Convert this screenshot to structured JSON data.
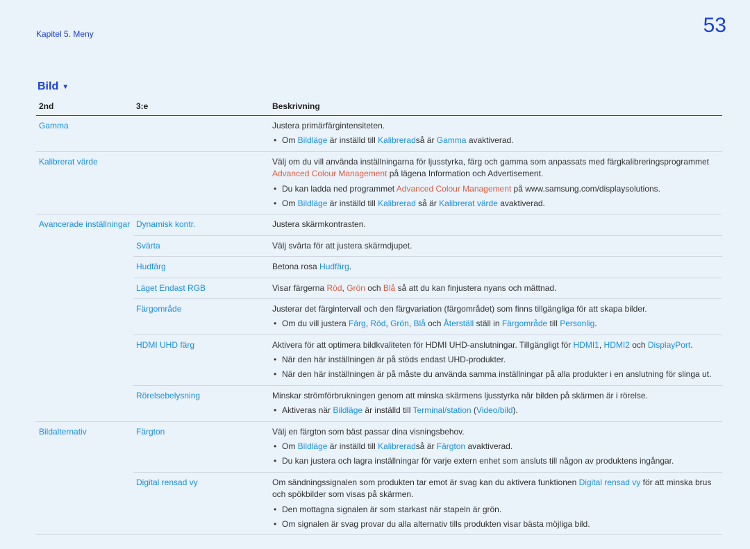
{
  "header": {
    "chapter": "Kapitel 5. Meny",
    "page": "53"
  },
  "section": {
    "title": "Bild"
  },
  "tableHead": {
    "c1": "2nd",
    "c2": "3:e",
    "c3": "Beskrivning"
  },
  "row1": {
    "c1": "Gamma",
    "p1": "Justera primärfärgintensiteten.",
    "b1_a": "Om ",
    "b1_b": "Bildläge",
    "b1_c": " är inställd till ",
    "b1_d": "Kalibrerad",
    "b1_e": "så är ",
    "b1_f": "Gamma",
    "b1_g": " avaktiverad."
  },
  "row2": {
    "c1": "Kalibrerat värde",
    "p1": "Välj om du vill använda inställningarna för ljusstyrka, färg och gamma som anpassats med färgkalibreringsprogrammet ",
    "p1_hl": "Advanced Colour Management",
    "p1_after": " på lägena Information och Advertisement.",
    "b1_a": "Du kan ladda ned programmet ",
    "b1_b": "Advanced Colour Management",
    "b1_c": " på www.samsung.com/displaysolutions.",
    "b2_a": "Om ",
    "b2_b": "Bildläge",
    "b2_c": " är inställd till ",
    "b2_d": "Kalibrerad",
    "b2_e": " så är ",
    "b2_f": "Kalibrerat värde",
    "b2_g": " avaktiverad."
  },
  "row3": {
    "c1": "Avancerade inställningar",
    "c2": "Dynamisk kontr.",
    "p1": "Justera skärmkontrasten."
  },
  "row4": {
    "c2": "Svärta",
    "p1": "Välj svärta för att justera skärmdjupet."
  },
  "row5": {
    "c2": "Hudfärg",
    "p1_a": "Betona rosa ",
    "p1_b": "Hudfärg",
    "p1_c": "."
  },
  "row6": {
    "c2": "Läget Endast RGB",
    "p1_a": "Visar färgerna ",
    "p1_b": "Röd",
    "p1_c": ", ",
    "p1_d": "Grön",
    "p1_e": " och ",
    "p1_f": "Blå",
    "p1_g": " så att du kan finjustera nyans och mättnad."
  },
  "row7": {
    "c2": "Färgområde",
    "p1": "Justerar det färgintervall och den färgvariation (färgområdet) som finns tillgängliga för att skapa bilder.",
    "b1_a": "Om du vill justera ",
    "b1_b": "Färg",
    "b1_c": ", ",
    "b1_d": "Röd",
    "b1_e": ", ",
    "b1_f": "Grön",
    "b1_g": ", ",
    "b1_h": "Blå",
    "b1_i": " och ",
    "b1_j": "Återställ",
    "b1_k": " ställ in ",
    "b1_l": "Färgområde",
    "b1_m": " till ",
    "b1_n": "Personlig",
    "b1_o": "."
  },
  "row8": {
    "c2": "HDMI UHD färg",
    "p1_a": "Aktivera för att optimera bildkvaliteten för HDMI UHD-anslutningar. Tillgängligt för ",
    "p1_b": "HDMI1",
    "p1_c": ", ",
    "p1_d": "HDMI2",
    "p1_e": " och ",
    "p1_f": "DisplayPort",
    "p1_g": ".",
    "b1": "När den här inställningen är på stöds endast UHD-produkter.",
    "b2": "När den här inställningen är på måste du använda samma inställningar på alla produkter i en anslutning för slinga ut."
  },
  "row9": {
    "c2": "Rörelsebelysning",
    "p1": "Minskar strömförbrukningen genom att minska skärmens ljusstyrka när bilden på skärmen är i rörelse.",
    "b1_a": "Aktiveras när ",
    "b1_b": "Bildläge",
    "b1_c": " är inställd till ",
    "b1_d": "Terminal/station",
    "b1_e": " (",
    "b1_f": "Video/bild",
    "b1_g": ")."
  },
  "row10": {
    "c1": "Bildalternativ",
    "c2": "Färgton",
    "p1": "Välj en färgton som bäst passar dina visningsbehov.",
    "b1_a": "Om ",
    "b1_b": "Bildläge",
    "b1_c": " är inställd till ",
    "b1_d": "Kalibrerad",
    "b1_e": "så är ",
    "b1_f": "Färgton",
    "b1_g": " avaktiverad.",
    "b2": "Du kan justera och lagra inställningar för varje extern enhet som ansluts till någon av produktens ingångar."
  },
  "row11": {
    "c2": "Digital rensad vy",
    "p1_a": "Om sändningssignalen som produkten tar emot är svag kan du aktivera funktionen ",
    "p1_b": "Digital rensad vy",
    "p1_c": " för att minska brus och spökbilder som visas på skärmen.",
    "b1": "Den mottagna signalen är som starkast när stapeln är grön.",
    "b2": "Om signalen är svag provar du alla alternativ tills produkten visar bästa möjliga bild."
  }
}
